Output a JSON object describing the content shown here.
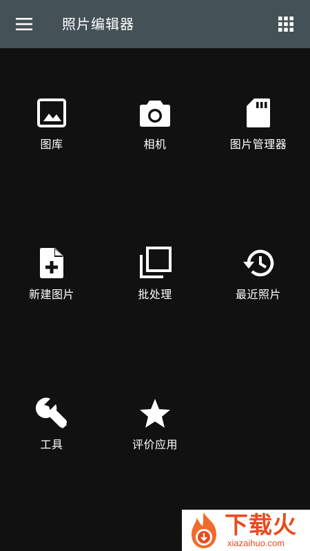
{
  "app_bar": {
    "title": "照片编辑器",
    "menu_icon": "hamburger-menu-icon",
    "apps_icon": "apps-grid-icon",
    "background_color": "#445157"
  },
  "tiles": [
    {
      "label": "图库",
      "icon": "image-icon"
    },
    {
      "label": "相机",
      "icon": "camera-icon"
    },
    {
      "label": "图片管理器",
      "icon": "sd-card-icon"
    },
    {
      "label": "新建图片",
      "icon": "new-file-icon"
    },
    {
      "label": "批处理",
      "icon": "batch-layers-icon"
    },
    {
      "label": "最近照片",
      "icon": "history-icon"
    },
    {
      "label": "工具",
      "icon": "wrench-icon"
    },
    {
      "label": "评价应用",
      "icon": "star-icon"
    }
  ],
  "watermark": {
    "text": "下载火",
    "url": "xiazaihuo.com",
    "color": "#e94b1c"
  },
  "colors": {
    "background": "#111111",
    "foreground": "#ffffff"
  }
}
